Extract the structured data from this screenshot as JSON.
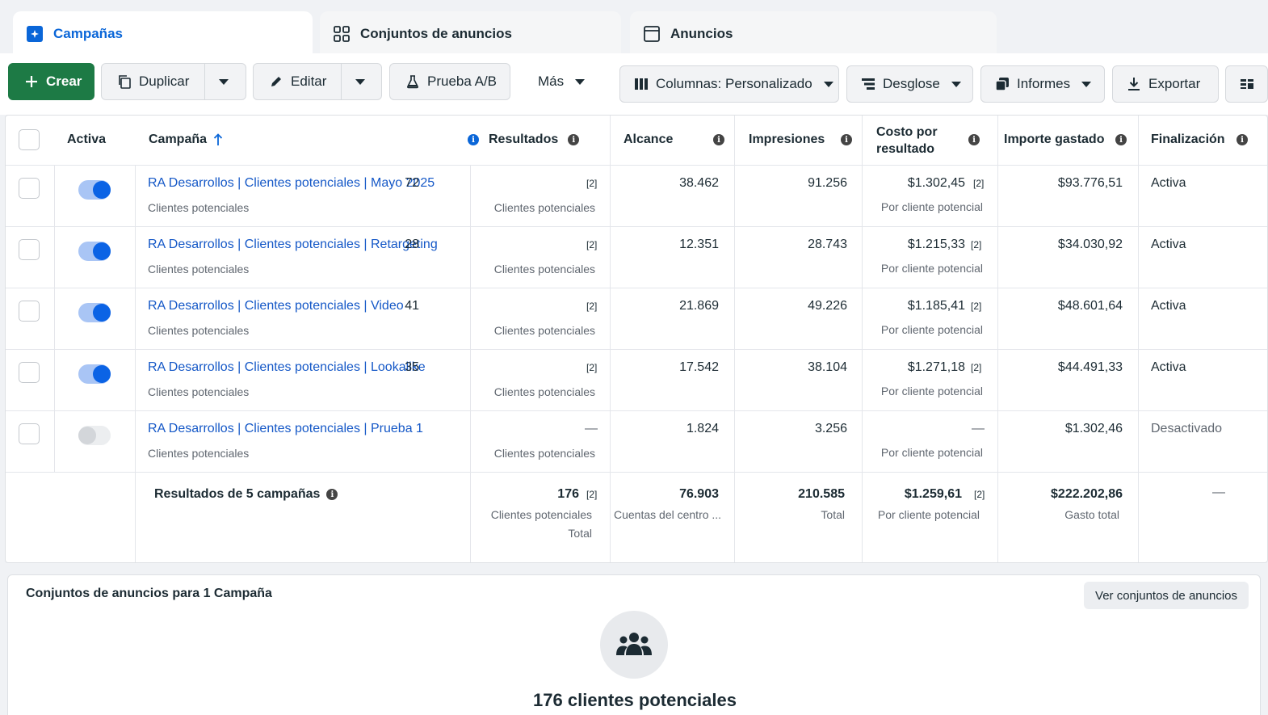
{
  "tabs": [
    {
      "label": "Campañas",
      "icon": "campaign-icon"
    },
    {
      "label": "Conjuntos de anuncios",
      "icon": "grid-icon"
    },
    {
      "label": "Anuncios",
      "icon": "ad-icon"
    }
  ],
  "toolbar": {
    "create": "Crear",
    "duplicate": "Duplicar",
    "edit": "Editar",
    "ab_test": "Prueba A/B",
    "more": "Más",
    "columns": "Columnas: Personalizado",
    "breakdown": "Desglose",
    "reports": "Informes",
    "export": "Exportar"
  },
  "table": {
    "headers": {
      "active": "Activa",
      "campaign": "Campaña",
      "results": "Resultados",
      "reach": "Alcance",
      "impressions": "Impresiones",
      "cost_per_result_1": "Costo por",
      "cost_per_result_2": "resultado",
      "amount_spent": "Importe gastado",
      "end": "Finalización"
    },
    "rows": [
      {
        "name": "RA Desarrollos | Clientes potenciales | Mayo 2025",
        "objective": "Clientes potenciales",
        "results": "72",
        "results_note": "[2]",
        "results_sub": "Clientes potenciales",
        "reach": "38.462",
        "impressions": "91.256",
        "cost": "$1.302,45",
        "cost_note": "[2]",
        "cost_sub": "Por cliente potencial",
        "spent": "$93.776,51",
        "status": "Activa",
        "on": true
      },
      {
        "name": "RA Desarrollos | Clientes potenciales | Retargeting",
        "objective": "Clientes potenciales",
        "results": "28",
        "results_note": "[2]",
        "results_sub": "Clientes potenciales",
        "reach": "12.351",
        "impressions": "28.743",
        "cost": "$1.215,33",
        "cost_note": "[2]",
        "cost_sub": "Por cliente potencial",
        "spent": "$34.030,92",
        "status": "Activa",
        "on": true
      },
      {
        "name": "RA Desarrollos | Clientes potenciales | Video",
        "objective": "Clientes potenciales",
        "results": "41",
        "results_note": "[2]",
        "results_sub": "Clientes potenciales",
        "reach": "21.869",
        "impressions": "49.226",
        "cost": "$1.185,41",
        "cost_note": "[2]",
        "cost_sub": "Por cliente potencial",
        "spent": "$48.601,64",
        "status": "Activa",
        "on": true
      },
      {
        "name": "RA Desarrollos | Clientes potenciales | Lookalike",
        "objective": "Clientes potenciales",
        "results": "35",
        "results_note": "[2]",
        "results_sub": "Clientes potenciales",
        "reach": "17.542",
        "impressions": "38.104",
        "cost": "$1.271,18",
        "cost_note": "[2]",
        "cost_sub": "Por cliente potencial",
        "spent": "$44.491,33",
        "status": "Activa",
        "on": true
      },
      {
        "name": "RA Desarrollos | Clientes potenciales | Prueba 1",
        "objective": "Clientes potenciales",
        "results": "—",
        "results_note": "",
        "results_sub": "Clientes potenciales",
        "reach": "1.824",
        "impressions": "3.256",
        "cost": "—",
        "cost_note": "",
        "cost_sub": "Por cliente potencial",
        "spent": "$1.302,46",
        "status": "Desactivado",
        "on": false
      }
    ],
    "totals": {
      "label": "Resultados de 5 campañas",
      "results": "176",
      "results_note": "[2]",
      "results_sub1": "Clientes potenciales",
      "results_sub2": "Total",
      "reach": "76.903",
      "reach_sub": "Cuentas del centro ...",
      "impressions": "210.585",
      "impressions_sub": "Total",
      "cost": "$1.259,61",
      "cost_note": "[2]",
      "cost_sub": "Por cliente potencial",
      "spent": "$222.202,86",
      "spent_sub": "Gasto total",
      "end": "—"
    }
  },
  "panel": {
    "title": "Conjuntos de anuncios para 1 Campaña",
    "button": "Ver conjuntos de anuncios",
    "icon": "people-icon",
    "summary": "176 clientes potenciales"
  },
  "colors": {
    "accent": "#0a66d8",
    "primary_button": "#1d7a45",
    "link": "#1558c7"
  }
}
